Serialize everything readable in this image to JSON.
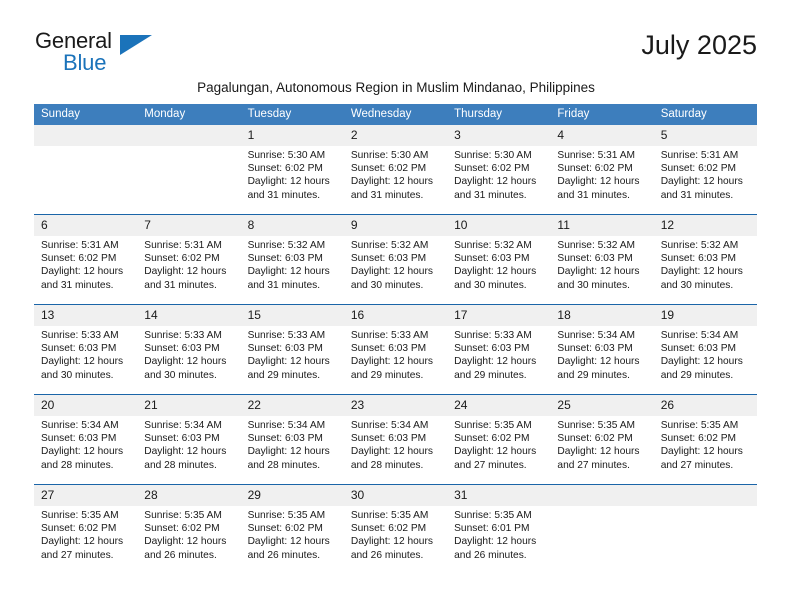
{
  "brand": {
    "name_primary": "General",
    "name_secondary": "Blue",
    "logo_icon": "triangle-flag-icon",
    "accent_color": "#1b73ba"
  },
  "header": {
    "title": "July 2025",
    "subtitle": "Pagalungan, Autonomous Region in Muslim Mindanao, Philippines"
  },
  "calendar": {
    "header_bg_color": "#3d7ebd",
    "header_text_color": "#ffffff",
    "week_divider_color": "#1b65a8",
    "daynum_bg_color": "#f0f0f0",
    "weekdays": [
      "Sunday",
      "Monday",
      "Tuesday",
      "Wednesday",
      "Thursday",
      "Friday",
      "Saturday"
    ],
    "weeks": [
      [
        {
          "day": "",
          "sunrise": "",
          "sunset": "",
          "daylight": ""
        },
        {
          "day": "",
          "sunrise": "",
          "sunset": "",
          "daylight": ""
        },
        {
          "day": "1",
          "sunrise": "Sunrise: 5:30 AM",
          "sunset": "Sunset: 6:02 PM",
          "daylight": "Daylight: 12 hours and 31 minutes."
        },
        {
          "day": "2",
          "sunrise": "Sunrise: 5:30 AM",
          "sunset": "Sunset: 6:02 PM",
          "daylight": "Daylight: 12 hours and 31 minutes."
        },
        {
          "day": "3",
          "sunrise": "Sunrise: 5:30 AM",
          "sunset": "Sunset: 6:02 PM",
          "daylight": "Daylight: 12 hours and 31 minutes."
        },
        {
          "day": "4",
          "sunrise": "Sunrise: 5:31 AM",
          "sunset": "Sunset: 6:02 PM",
          "daylight": "Daylight: 12 hours and 31 minutes."
        },
        {
          "day": "5",
          "sunrise": "Sunrise: 5:31 AM",
          "sunset": "Sunset: 6:02 PM",
          "daylight": "Daylight: 12 hours and 31 minutes."
        }
      ],
      [
        {
          "day": "6",
          "sunrise": "Sunrise: 5:31 AM",
          "sunset": "Sunset: 6:02 PM",
          "daylight": "Daylight: 12 hours and 31 minutes."
        },
        {
          "day": "7",
          "sunrise": "Sunrise: 5:31 AM",
          "sunset": "Sunset: 6:02 PM",
          "daylight": "Daylight: 12 hours and 31 minutes."
        },
        {
          "day": "8",
          "sunrise": "Sunrise: 5:32 AM",
          "sunset": "Sunset: 6:03 PM",
          "daylight": "Daylight: 12 hours and 31 minutes."
        },
        {
          "day": "9",
          "sunrise": "Sunrise: 5:32 AM",
          "sunset": "Sunset: 6:03 PM",
          "daylight": "Daylight: 12 hours and 30 minutes."
        },
        {
          "day": "10",
          "sunrise": "Sunrise: 5:32 AM",
          "sunset": "Sunset: 6:03 PM",
          "daylight": "Daylight: 12 hours and 30 minutes."
        },
        {
          "day": "11",
          "sunrise": "Sunrise: 5:32 AM",
          "sunset": "Sunset: 6:03 PM",
          "daylight": "Daylight: 12 hours and 30 minutes."
        },
        {
          "day": "12",
          "sunrise": "Sunrise: 5:32 AM",
          "sunset": "Sunset: 6:03 PM",
          "daylight": "Daylight: 12 hours and 30 minutes."
        }
      ],
      [
        {
          "day": "13",
          "sunrise": "Sunrise: 5:33 AM",
          "sunset": "Sunset: 6:03 PM",
          "daylight": "Daylight: 12 hours and 30 minutes."
        },
        {
          "day": "14",
          "sunrise": "Sunrise: 5:33 AM",
          "sunset": "Sunset: 6:03 PM",
          "daylight": "Daylight: 12 hours and 30 minutes."
        },
        {
          "day": "15",
          "sunrise": "Sunrise: 5:33 AM",
          "sunset": "Sunset: 6:03 PM",
          "daylight": "Daylight: 12 hours and 29 minutes."
        },
        {
          "day": "16",
          "sunrise": "Sunrise: 5:33 AM",
          "sunset": "Sunset: 6:03 PM",
          "daylight": "Daylight: 12 hours and 29 minutes."
        },
        {
          "day": "17",
          "sunrise": "Sunrise: 5:33 AM",
          "sunset": "Sunset: 6:03 PM",
          "daylight": "Daylight: 12 hours and 29 minutes."
        },
        {
          "day": "18",
          "sunrise": "Sunrise: 5:34 AM",
          "sunset": "Sunset: 6:03 PM",
          "daylight": "Daylight: 12 hours and 29 minutes."
        },
        {
          "day": "19",
          "sunrise": "Sunrise: 5:34 AM",
          "sunset": "Sunset: 6:03 PM",
          "daylight": "Daylight: 12 hours and 29 minutes."
        }
      ],
      [
        {
          "day": "20",
          "sunrise": "Sunrise: 5:34 AM",
          "sunset": "Sunset: 6:03 PM",
          "daylight": "Daylight: 12 hours and 28 minutes."
        },
        {
          "day": "21",
          "sunrise": "Sunrise: 5:34 AM",
          "sunset": "Sunset: 6:03 PM",
          "daylight": "Daylight: 12 hours and 28 minutes."
        },
        {
          "day": "22",
          "sunrise": "Sunrise: 5:34 AM",
          "sunset": "Sunset: 6:03 PM",
          "daylight": "Daylight: 12 hours and 28 minutes."
        },
        {
          "day": "23",
          "sunrise": "Sunrise: 5:34 AM",
          "sunset": "Sunset: 6:03 PM",
          "daylight": "Daylight: 12 hours and 28 minutes."
        },
        {
          "day": "24",
          "sunrise": "Sunrise: 5:35 AM",
          "sunset": "Sunset: 6:02 PM",
          "daylight": "Daylight: 12 hours and 27 minutes."
        },
        {
          "day": "25",
          "sunrise": "Sunrise: 5:35 AM",
          "sunset": "Sunset: 6:02 PM",
          "daylight": "Daylight: 12 hours and 27 minutes."
        },
        {
          "day": "26",
          "sunrise": "Sunrise: 5:35 AM",
          "sunset": "Sunset: 6:02 PM",
          "daylight": "Daylight: 12 hours and 27 minutes."
        }
      ],
      [
        {
          "day": "27",
          "sunrise": "Sunrise: 5:35 AM",
          "sunset": "Sunset: 6:02 PM",
          "daylight": "Daylight: 12 hours and 27 minutes."
        },
        {
          "day": "28",
          "sunrise": "Sunrise: 5:35 AM",
          "sunset": "Sunset: 6:02 PM",
          "daylight": "Daylight: 12 hours and 26 minutes."
        },
        {
          "day": "29",
          "sunrise": "Sunrise: 5:35 AM",
          "sunset": "Sunset: 6:02 PM",
          "daylight": "Daylight: 12 hours and 26 minutes."
        },
        {
          "day": "30",
          "sunrise": "Sunrise: 5:35 AM",
          "sunset": "Sunset: 6:02 PM",
          "daylight": "Daylight: 12 hours and 26 minutes."
        },
        {
          "day": "31",
          "sunrise": "Sunrise: 5:35 AM",
          "sunset": "Sunset: 6:01 PM",
          "daylight": "Daylight: 12 hours and 26 minutes."
        },
        {
          "day": "",
          "sunrise": "",
          "sunset": "",
          "daylight": ""
        },
        {
          "day": "",
          "sunrise": "",
          "sunset": "",
          "daylight": ""
        }
      ]
    ]
  }
}
